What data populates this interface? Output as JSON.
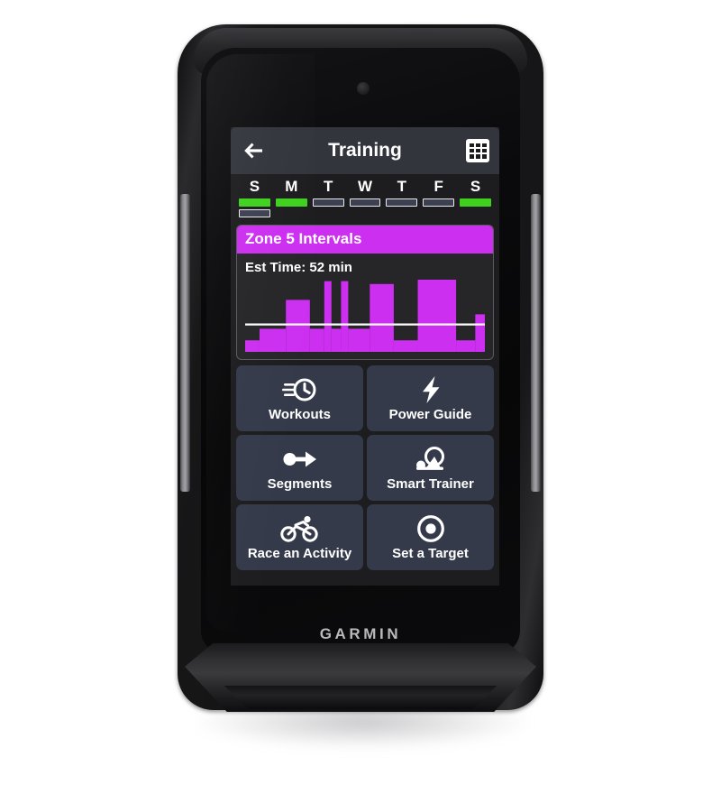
{
  "device": {
    "brand": "GARMIN",
    "light_sensor_name": "ambient-light-sensor"
  },
  "screen": {
    "header": {
      "back_icon": "back-arrow-icon",
      "title": "Training",
      "calendar_icon": "calendar-icon"
    },
    "week": {
      "days": [
        {
          "letter": "S",
          "bars": [
            "done",
            "planned"
          ]
        },
        {
          "letter": "M",
          "bars": [
            "done"
          ]
        },
        {
          "letter": "T",
          "bars": [
            "planned"
          ]
        },
        {
          "letter": "W",
          "bars": [
            "planned"
          ]
        },
        {
          "letter": "T",
          "bars": [
            "planned"
          ]
        },
        {
          "letter": "F",
          "bars": [
            "planned"
          ]
        },
        {
          "letter": "S",
          "bars": [
            "done"
          ]
        }
      ],
      "colors": {
        "completed": "#3fd11e",
        "planned_fill": "#3c4050",
        "planned_outline": "#e9e9ee"
      }
    },
    "workout_card": {
      "title": "Zone 5 Intervals",
      "est_time": "Est Time: 52 min",
      "accent_color": "#cc2ff0",
      "chart_data": {
        "type": "bar",
        "title": "Zone 5 Intervals workout power profile",
        "xlabel": "",
        "ylabel": "",
        "ylim": [
          0,
          100
        ],
        "grid": false,
        "legend": null,
        "bar_color": "#cc2ff0",
        "threshold_line": {
          "value": 38,
          "color": "#ffffff"
        },
        "x": [
          0,
          6,
          17,
          27,
          33,
          36,
          40,
          43,
          52,
          62,
          72,
          80,
          88,
          96,
          100
        ],
        "steps": [
          {
            "start": 0,
            "end": 6,
            "value": 16
          },
          {
            "start": 6,
            "end": 17,
            "value": 32
          },
          {
            "start": 17,
            "end": 27,
            "value": 72
          },
          {
            "start": 27,
            "end": 33,
            "value": 32
          },
          {
            "start": 33,
            "end": 36,
            "value": 98
          },
          {
            "start": 36,
            "end": 40,
            "value": 32
          },
          {
            "start": 40,
            "end": 43,
            "value": 98
          },
          {
            "start": 43,
            "end": 52,
            "value": 32
          },
          {
            "start": 52,
            "end": 62,
            "value": 94
          },
          {
            "start": 62,
            "end": 72,
            "value": 16
          },
          {
            "start": 72,
            "end": 88,
            "value": 100
          },
          {
            "start": 88,
            "end": 96,
            "value": 16
          },
          {
            "start": 96,
            "end": 100,
            "value": 52
          }
        ]
      }
    },
    "tiles": [
      {
        "label": "Workouts",
        "icon": "clock-speed-icon"
      },
      {
        "label": "Power Guide",
        "icon": "lightning-bolt-icon"
      },
      {
        "label": "Segments",
        "icon": "dot-arrow-icon"
      },
      {
        "label": "Smart Trainer",
        "icon": "trainer-wheel-icon"
      },
      {
        "label": "Race an Activity",
        "icon": "cyclist-icon"
      },
      {
        "label": "Set a Target",
        "icon": "bullseye-target-icon"
      }
    ]
  }
}
